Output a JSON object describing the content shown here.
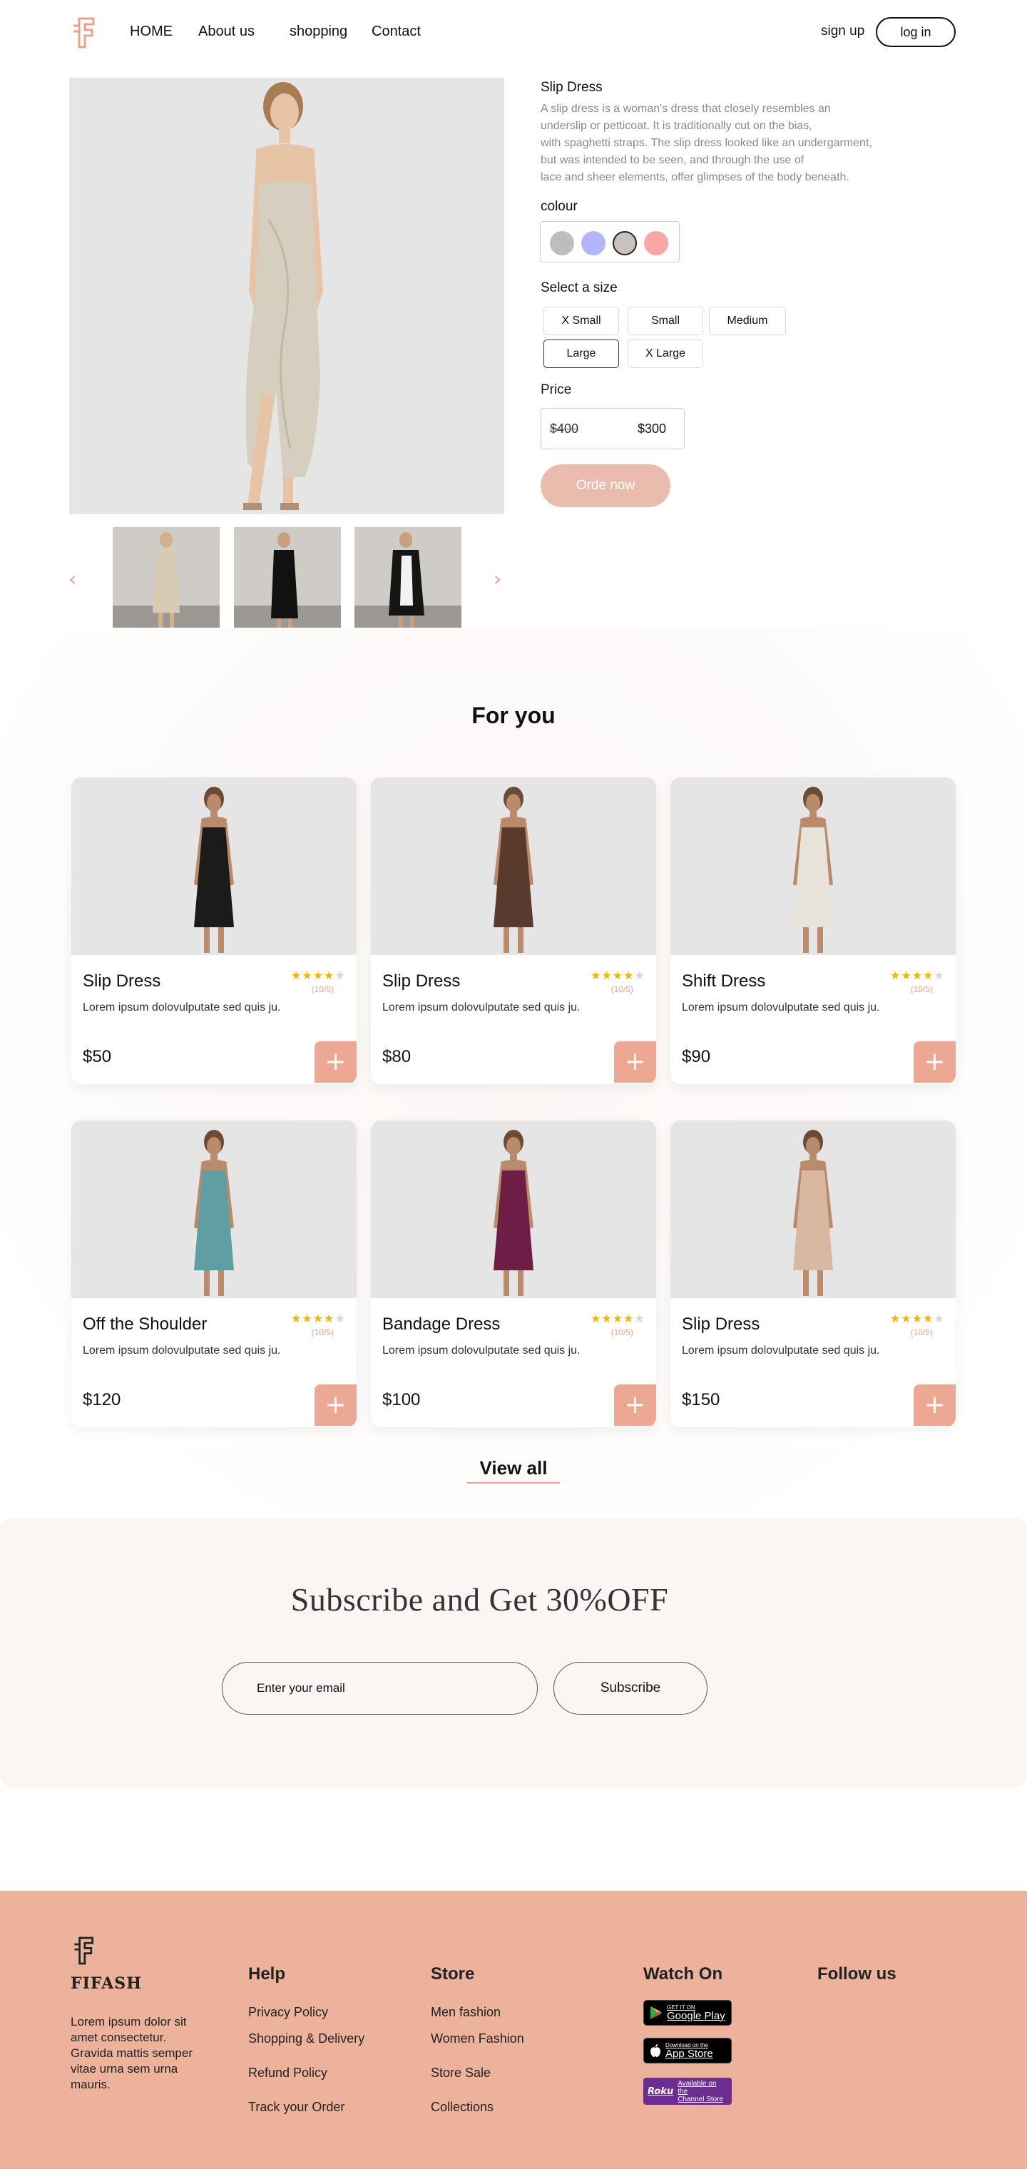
{
  "nav": {
    "home": "HOME",
    "about": "About us",
    "shopping": "shopping",
    "contact": "Contact",
    "signup": "sign up",
    "login": "log in"
  },
  "product": {
    "title": "Slip Dress",
    "description": "A slip dress is a woman's dress that closely resembles an\nunderslip or petticoat. It is traditionally cut on the bias,\nwith spaghetti straps. The slip dress looked like an undergarment,\n but was intended to be seen, and through the use of\n lace and sheer elements, offer glimpses of the body beneath.",
    "colour_label": "colour",
    "colours": [
      "#bdbdbd",
      "#b3b6fb",
      "#c9c1bb",
      "#f9a6a6"
    ],
    "selected_colour_index": 2,
    "size_label": "Select a size",
    "sizes": [
      "X Small",
      "Small",
      "Medium",
      "Large",
      "X Large"
    ],
    "selected_size": "Large",
    "price_label": "Price",
    "old_price": "$400",
    "new_price": "$300",
    "order_label": "Orde now"
  },
  "for_you": {
    "title": "For you",
    "cards": [
      {
        "name": "Slip Dress",
        "rating_text": "(10/5)",
        "stars": 4,
        "desc": "Lorem ipsum dolovulputate sed quis ju.",
        "price": "$50",
        "dress_color": "#1b1b1b"
      },
      {
        "name": "Slip Dress",
        "rating_text": "(10/5)",
        "stars": 4,
        "desc": "Lorem ipsum dolovulputate sed quis ju.",
        "price": "$80",
        "dress_color": "#5a3a2c"
      },
      {
        "name": "Shift Dress",
        "rating_text": "(10/5)",
        "stars": 4,
        "desc": "Lorem ipsum dolovulputate sed quis ju.",
        "price": "$90",
        "dress_color": "#e8e4dc"
      },
      {
        "name": "Off the Shoulder",
        "rating_text": "(10/5)",
        "stars": 4,
        "desc": "Lorem ipsum dolovulputate sed quis ju.",
        "price": "$120",
        "dress_color": "#5f9fa3"
      },
      {
        "name": "Bandage Dress",
        "rating_text": "(10/5)",
        "stars": 4,
        "desc": "Lorem ipsum dolovulputate sed quis ju.",
        "price": "$100",
        "dress_color": "#6e1e46"
      },
      {
        "name": "Slip Dress",
        "rating_text": "(10/5)",
        "stars": 4,
        "desc": "Lorem ipsum dolovulputate sed quis ju.",
        "price": "$150",
        "dress_color": "#d8b8a0"
      }
    ],
    "view_all": "View all"
  },
  "subscribe": {
    "title": "Subscribe and Get 30%OFF",
    "placeholder": "Enter your email",
    "button": "Subscribe"
  },
  "footer": {
    "brand": "FIFASH",
    "blurb": "Lorem ipsum dolor sit amet consectetur. Gravida mattis semper vitae urna sem urna mauris.",
    "help": {
      "title": "Help",
      "links": [
        "Privacy Policy",
        "Shopping & Delivery",
        "Refund Policy",
        "Track your Order"
      ]
    },
    "store": {
      "title": "Store",
      "links": [
        "Men fashion",
        "Women Fashion",
        "Store Sale",
        "Collections"
      ]
    },
    "watch": {
      "title": "Watch On",
      "google_small": "GET IT ON",
      "google_big": "Google Play",
      "apple_small": "Download on the",
      "apple_big": "App Store",
      "roku_brand": "Roku",
      "roku_small": "Available on the",
      "roku_big": "Channel Store"
    },
    "follow": {
      "title": "Follow us"
    }
  },
  "colors": {
    "accent": "#eca893",
    "footer_bg": "#ecb29c",
    "order_button": "#e9bcad",
    "star": "#f5b400"
  }
}
